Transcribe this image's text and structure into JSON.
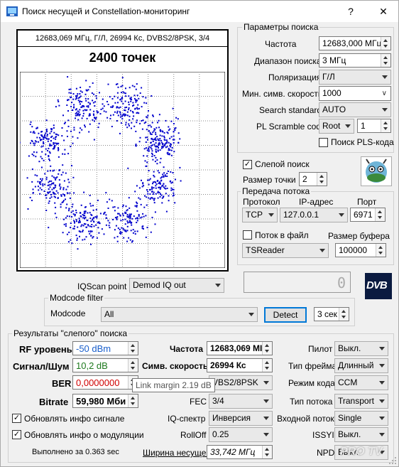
{
  "window": {
    "title": "Поиск несущей и Constellation-мониторинг",
    "help": "?",
    "close": "✕"
  },
  "plot": {
    "info": "12683,069 МГц, Г/Л, 26994 Кс, DVBS2/8PSK, 3/4",
    "points_label": "2400 точек",
    "point_color": "#0000cc"
  },
  "search_params": {
    "group_title": "Параметры поиска",
    "freq_label": "Частота",
    "freq_value": "12683,000 МГц",
    "range_label": "Диапазон поиска",
    "range_value": "3 МГц",
    "pol_label": "Поляризация",
    "pol_value": "Г/Л",
    "minsr_label": "Мин. симв. скорость",
    "minsr_value": "1000",
    "standard_label": "Search standard",
    "standard_value": "AUTO",
    "pls_label": "PL Scramble code",
    "pls_mode": "Root",
    "pls_value": "1",
    "pls_search_label": "Поиск PLS-кода",
    "pls_search_checked": false
  },
  "blind": {
    "blind_label": "Слепой поиск",
    "blind_checked": true,
    "point_size_label": "Размер точки",
    "point_size_value": "2"
  },
  "stream": {
    "group_title": "Передача потока",
    "protocol_header": "Протокол",
    "ip_header": "IP-адрес",
    "port_header": "Порт",
    "protocol_value": "TCP",
    "ip_value": "127.0.0.1",
    "port_value": "6971",
    "file_label": "Поток в файл",
    "file_checked": false,
    "buffer_label": "Размер буфера",
    "reader_value": "TSReader",
    "buffer_value": "100000"
  },
  "display": {
    "digit": "0",
    "logo_text": "DVB"
  },
  "iq": {
    "label": "IQScan point",
    "value": "Demod IQ out"
  },
  "modcode": {
    "group_title": "Modcode filter",
    "label": "Modcode",
    "value": "All",
    "detect_button": "Detect",
    "time_value": "3 сек"
  },
  "results": {
    "group_title": "Результаты \"слепого\" поиска",
    "rf_label": "RF уровень",
    "rf_value": "-50 dBm",
    "snr_label": "Сигнал/Шум",
    "snr_value": "10,2 dB",
    "ber_label": "BER",
    "ber_value": "0,0000000",
    "bitrate_label": "Bitrate",
    "bitrate_value": "59,980 Мби",
    "freq_label": "Частота",
    "freq_value": "12683,069 МІ",
    "sr_label": "Симв. скорость",
    "sr_value": "26994 Кс",
    "mod_value": "VBS2/8PSK",
    "fec_label": "FEC",
    "fec_value": "3/4",
    "iqspec_label": "IQ-спектр",
    "iqspec_value": "Инверсия",
    "rolloff_label": "RollOff",
    "rolloff_value": "0.25",
    "bw_label": "Ширина несущей",
    "bw_value": "33,742 МГц",
    "pilot_label": "Пилот",
    "pilot_value": "Выкл.",
    "frame_label": "Тип фрейма",
    "frame_value": "Длинный",
    "code_label": "Режим кода",
    "code_value": "CCM",
    "stream_type_label": "Тип потока",
    "stream_type_value": "Transport",
    "input_label": "Входной поток",
    "input_value": "Single",
    "issyi_label": "ISSYI",
    "issyi_value": "Выкл.",
    "npd_label": "NPD",
    "npd_value": "Выкл.",
    "upd_sig_label": "Обновлять инфо сигнале",
    "upd_sig_checked": true,
    "upd_mod_label": "Обновлять инфо о модуляции",
    "upd_mod_checked": true,
    "done_text": "Выполнено за 0.363 sec",
    "tooltip": "Link margin 2.19 dB"
  },
  "watermark": "PRO TV"
}
